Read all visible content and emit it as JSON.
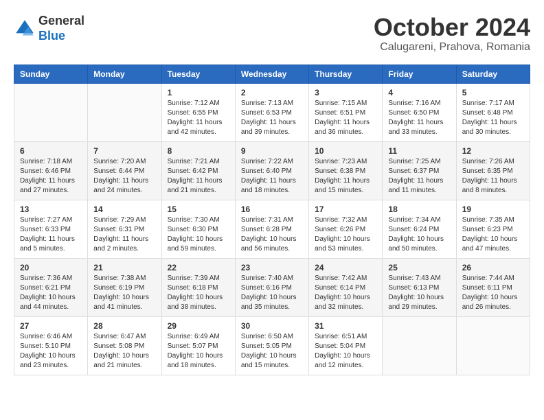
{
  "header": {
    "logo_line1": "General",
    "logo_line2": "Blue",
    "month": "October 2024",
    "location": "Calugareni, Prahova, Romania"
  },
  "days_of_week": [
    "Sunday",
    "Monday",
    "Tuesday",
    "Wednesday",
    "Thursday",
    "Friday",
    "Saturday"
  ],
  "weeks": [
    [
      {
        "day": "",
        "content": ""
      },
      {
        "day": "",
        "content": ""
      },
      {
        "day": "1",
        "content": "Sunrise: 7:12 AM\nSunset: 6:55 PM\nDaylight: 11 hours and 42 minutes."
      },
      {
        "day": "2",
        "content": "Sunrise: 7:13 AM\nSunset: 6:53 PM\nDaylight: 11 hours and 39 minutes."
      },
      {
        "day": "3",
        "content": "Sunrise: 7:15 AM\nSunset: 6:51 PM\nDaylight: 11 hours and 36 minutes."
      },
      {
        "day": "4",
        "content": "Sunrise: 7:16 AM\nSunset: 6:50 PM\nDaylight: 11 hours and 33 minutes."
      },
      {
        "day": "5",
        "content": "Sunrise: 7:17 AM\nSunset: 6:48 PM\nDaylight: 11 hours and 30 minutes."
      }
    ],
    [
      {
        "day": "6",
        "content": "Sunrise: 7:18 AM\nSunset: 6:46 PM\nDaylight: 11 hours and 27 minutes."
      },
      {
        "day": "7",
        "content": "Sunrise: 7:20 AM\nSunset: 6:44 PM\nDaylight: 11 hours and 24 minutes."
      },
      {
        "day": "8",
        "content": "Sunrise: 7:21 AM\nSunset: 6:42 PM\nDaylight: 11 hours and 21 minutes."
      },
      {
        "day": "9",
        "content": "Sunrise: 7:22 AM\nSunset: 6:40 PM\nDaylight: 11 hours and 18 minutes."
      },
      {
        "day": "10",
        "content": "Sunrise: 7:23 AM\nSunset: 6:38 PM\nDaylight: 11 hours and 15 minutes."
      },
      {
        "day": "11",
        "content": "Sunrise: 7:25 AM\nSunset: 6:37 PM\nDaylight: 11 hours and 11 minutes."
      },
      {
        "day": "12",
        "content": "Sunrise: 7:26 AM\nSunset: 6:35 PM\nDaylight: 11 hours and 8 minutes."
      }
    ],
    [
      {
        "day": "13",
        "content": "Sunrise: 7:27 AM\nSunset: 6:33 PM\nDaylight: 11 hours and 5 minutes."
      },
      {
        "day": "14",
        "content": "Sunrise: 7:29 AM\nSunset: 6:31 PM\nDaylight: 11 hours and 2 minutes."
      },
      {
        "day": "15",
        "content": "Sunrise: 7:30 AM\nSunset: 6:30 PM\nDaylight: 10 hours and 59 minutes."
      },
      {
        "day": "16",
        "content": "Sunrise: 7:31 AM\nSunset: 6:28 PM\nDaylight: 10 hours and 56 minutes."
      },
      {
        "day": "17",
        "content": "Sunrise: 7:32 AM\nSunset: 6:26 PM\nDaylight: 10 hours and 53 minutes."
      },
      {
        "day": "18",
        "content": "Sunrise: 7:34 AM\nSunset: 6:24 PM\nDaylight: 10 hours and 50 minutes."
      },
      {
        "day": "19",
        "content": "Sunrise: 7:35 AM\nSunset: 6:23 PM\nDaylight: 10 hours and 47 minutes."
      }
    ],
    [
      {
        "day": "20",
        "content": "Sunrise: 7:36 AM\nSunset: 6:21 PM\nDaylight: 10 hours and 44 minutes."
      },
      {
        "day": "21",
        "content": "Sunrise: 7:38 AM\nSunset: 6:19 PM\nDaylight: 10 hours and 41 minutes."
      },
      {
        "day": "22",
        "content": "Sunrise: 7:39 AM\nSunset: 6:18 PM\nDaylight: 10 hours and 38 minutes."
      },
      {
        "day": "23",
        "content": "Sunrise: 7:40 AM\nSunset: 6:16 PM\nDaylight: 10 hours and 35 minutes."
      },
      {
        "day": "24",
        "content": "Sunrise: 7:42 AM\nSunset: 6:14 PM\nDaylight: 10 hours and 32 minutes."
      },
      {
        "day": "25",
        "content": "Sunrise: 7:43 AM\nSunset: 6:13 PM\nDaylight: 10 hours and 29 minutes."
      },
      {
        "day": "26",
        "content": "Sunrise: 7:44 AM\nSunset: 6:11 PM\nDaylight: 10 hours and 26 minutes."
      }
    ],
    [
      {
        "day": "27",
        "content": "Sunrise: 6:46 AM\nSunset: 5:10 PM\nDaylight: 10 hours and 23 minutes."
      },
      {
        "day": "28",
        "content": "Sunrise: 6:47 AM\nSunset: 5:08 PM\nDaylight: 10 hours and 21 minutes."
      },
      {
        "day": "29",
        "content": "Sunrise: 6:49 AM\nSunset: 5:07 PM\nDaylight: 10 hours and 18 minutes."
      },
      {
        "day": "30",
        "content": "Sunrise: 6:50 AM\nSunset: 5:05 PM\nDaylight: 10 hours and 15 minutes."
      },
      {
        "day": "31",
        "content": "Sunrise: 6:51 AM\nSunset: 5:04 PM\nDaylight: 10 hours and 12 minutes."
      },
      {
        "day": "",
        "content": ""
      },
      {
        "day": "",
        "content": ""
      }
    ]
  ]
}
